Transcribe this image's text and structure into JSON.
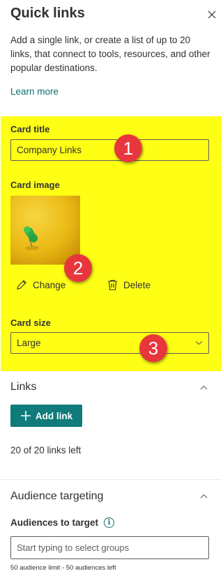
{
  "panel": {
    "title": "Quick links",
    "description": "Add a single link, or create a list of up to 20 links, that connect to tools, resources, and other popular destinations.",
    "learn_more": "Learn more"
  },
  "card": {
    "title_label": "Card title",
    "title_value": "Company Links",
    "image_label": "Card image",
    "change_label": "Change",
    "delete_label": "Delete",
    "size_label": "Card size",
    "size_value": "Large"
  },
  "links_section": {
    "title": "Links",
    "add_link_label": "Add link",
    "links_left": "20 of 20 links left"
  },
  "audience_section": {
    "title": "Audience targeting",
    "audiences_label": "Audiences to target",
    "input_placeholder": "Start typing to select groups",
    "limit_text": "50 audience limit - 50 audiences left"
  },
  "callouts": [
    "1",
    "2",
    "3"
  ],
  "colors": {
    "highlight": "#ffff16",
    "accent": "#0f7b7b",
    "callout": "#e8373c",
    "text": "#323130"
  },
  "icons": [
    "close-icon",
    "pencil-icon",
    "trash-icon",
    "chevron-down-icon",
    "chevron-up-icon",
    "plus-icon",
    "info-icon"
  ]
}
